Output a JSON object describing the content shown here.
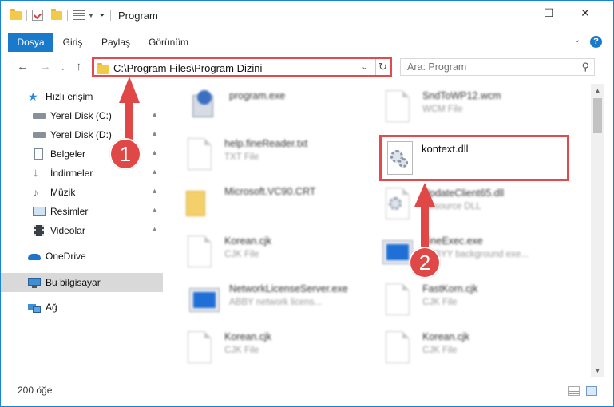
{
  "window": {
    "title": "Program"
  },
  "ribbon": {
    "tabs": [
      "Dosya",
      "Giriş",
      "Paylaş",
      "Görünüm"
    ],
    "help": "?"
  },
  "nav": {
    "address": "C:\\Program Files\\Program Dizini",
    "search_placeholder": "Ara: Program"
  },
  "sidebar": {
    "items": [
      {
        "label": "Hızlı erişim",
        "icon": "star-icon"
      },
      {
        "label": "Yerel Disk (C:)",
        "icon": "drive-icon",
        "pinned": true
      },
      {
        "label": "Yerel Disk (D:)",
        "icon": "drive-icon",
        "pinned": true
      },
      {
        "label": "Belgeler",
        "icon": "documents-icon",
        "pinned": true
      },
      {
        "label": "İndirmeler",
        "icon": "downloads-icon",
        "pinned": true
      },
      {
        "label": "Müzik",
        "icon": "music-icon",
        "pinned": true
      },
      {
        "label": "Resimler",
        "icon": "pictures-icon",
        "pinned": true
      },
      {
        "label": "Videolar",
        "icon": "videos-icon",
        "pinned": true
      },
      {
        "label": "OneDrive",
        "icon": "cloud-icon"
      },
      {
        "label": "Bu bilgisayar",
        "icon": "computer-icon",
        "selected": true
      },
      {
        "label": "Ağ",
        "icon": "network-icon"
      }
    ]
  },
  "files": [
    {
      "name": "program.exe",
      "desc": ""
    },
    {
      "name": "SndToWP12.wcm",
      "desc": "WCM File"
    },
    {
      "name": "help.fineReader.txt",
      "desc": "TXT File"
    },
    {
      "name": "kontext.dll",
      "desc": ""
    },
    {
      "name": "Microsoft.VC90.CRT",
      "desc": ""
    },
    {
      "name": "UpdateClient65.dll",
      "desc": "Resource DLL"
    },
    {
      "name": "Korean.cjk",
      "desc": "CJK File"
    },
    {
      "name": "FineExec.exe",
      "desc": "ABBYY background exe..."
    },
    {
      "name": "NetworkLicenseServer.exe",
      "desc": "ABBY network licens..."
    },
    {
      "name": "FastKorn.cjk",
      "desc": "CJK File"
    },
    {
      "name": "Korean.cjk",
      "desc": "CJK File"
    },
    {
      "name": "Korean.cjk",
      "desc": "CJK File"
    }
  ],
  "status": {
    "count": "200 öğe"
  },
  "callouts": [
    "1",
    "2"
  ],
  "colors": {
    "accent": "#1979ca",
    "highlight": "#e24b4b"
  }
}
